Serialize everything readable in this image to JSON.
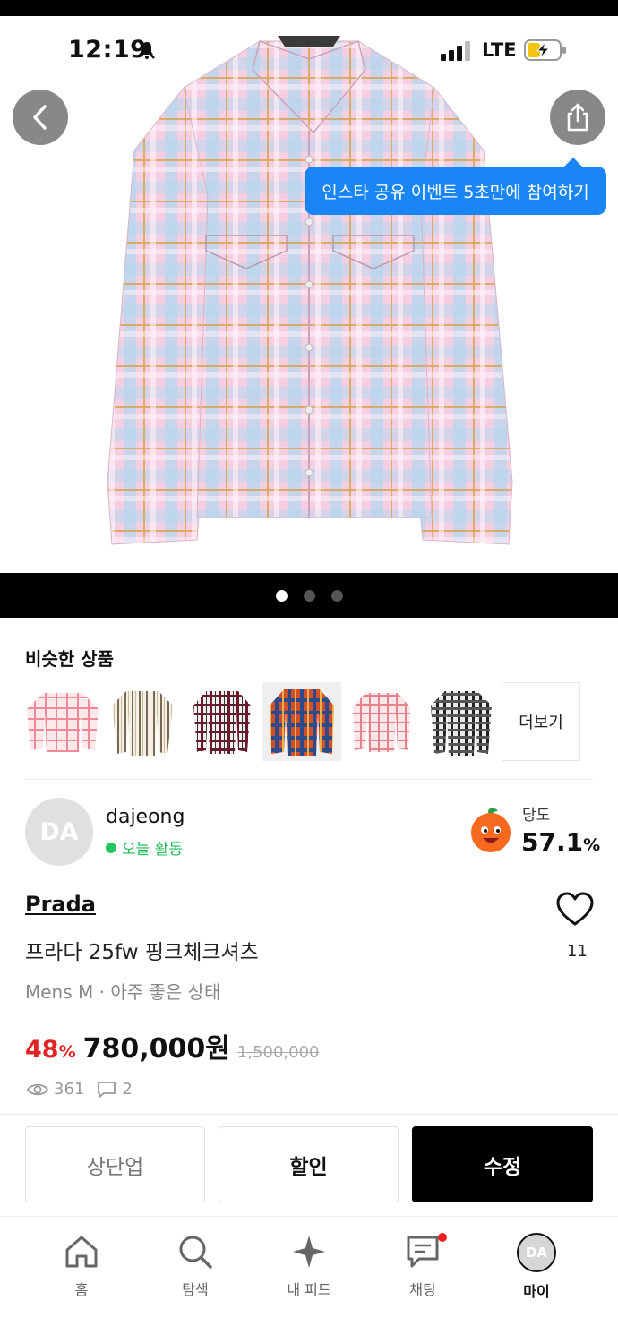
{
  "status_bar": {
    "time": "12:19",
    "network": "LTE"
  },
  "tooltip": {
    "text": "인스타 공유 이벤트 5초만에 참여하기"
  },
  "gallery": {
    "page_count": 3,
    "active_index": 0
  },
  "similar": {
    "title": "비슷한 상품",
    "more_label": "더보기"
  },
  "seller": {
    "avatar_initials": "DA",
    "name": "dajeong",
    "activity": "오늘 활동"
  },
  "sweetness": {
    "label": "당도",
    "value": "57.1",
    "unit": "%"
  },
  "product": {
    "brand": "Prada",
    "title": "프라다 25fw 핑크체크셔츠",
    "meta": "Mens M · 아주 좋은 상태",
    "discount_value": "48",
    "discount_unit": "%",
    "price": "780,000원",
    "original_price": "1,500,000",
    "likes": "11",
    "views": "361",
    "comments": "2"
  },
  "actions": {
    "bump": "상단업",
    "discount": "할인",
    "edit": "수정"
  },
  "nav": {
    "home": "홈",
    "explore": "탐색",
    "feed": "내 피드",
    "chat": "채팅",
    "my": "마이",
    "my_avatar": "DA"
  },
  "colors": {
    "tooltip_bg": "#1a86f5",
    "discount_red": "#e02424",
    "active_green": "#22c55e",
    "shirt_pink": "#f2c6dc",
    "shirt_blue": "#a9cde9"
  }
}
